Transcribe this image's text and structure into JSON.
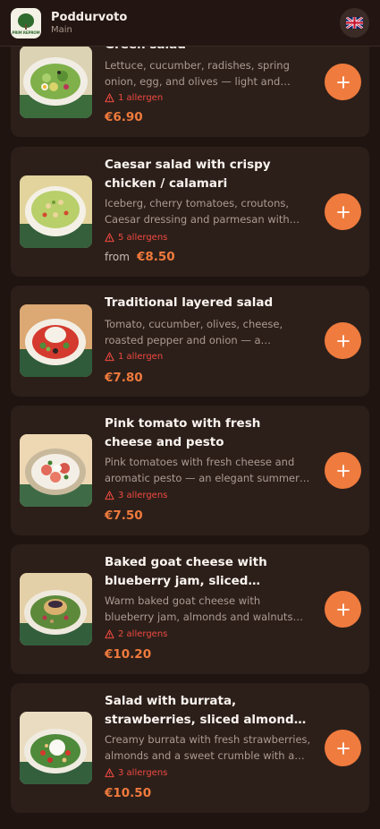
{
  "header": {
    "logo_text": "PRIM REPROM",
    "title": "Poddurvoto",
    "subtitle": "Main",
    "language_icon": "uk-flag-icon"
  },
  "items": [
    {
      "title": "Green salad",
      "description": "Lettuce, cucumber, radishes, spring onion, egg, and olives — light and fresh.",
      "allergens": "1 allergen",
      "price_prefix": "",
      "price": "€6.90"
    },
    {
      "title": "Caesar salad with crispy chicken / calamari",
      "description": "Iceberg, cherry tomatoes, croutons, Caesar dressing and parmesan with crispy chicken or calamari.",
      "allergens": "5 allergens",
      "price_prefix": "from",
      "price": "€8.50"
    },
    {
      "title": "Traditional layered salad",
      "description": "Tomato, cucumber, olives, cheese, roasted pepper and onion — a traditional favourite.",
      "allergens": "1 allergen",
      "price_prefix": "",
      "price": "€7.80"
    },
    {
      "title": "Pink tomato with fresh cheese and pesto",
      "description": "Pink tomatoes with fresh cheese and aromatic pesto — an elegant summer salad.",
      "allergens": "3 allergens",
      "price_prefix": "",
      "price": "€7.50"
    },
    {
      "title": "Baked goat cheese with blueberry jam, sliced almonds, walnuts and mixed salad",
      "description": "Warm baked goat cheese with blueberry jam, almonds and walnuts over a mix of leaves.",
      "allergens": "2 allergens",
      "price_prefix": "",
      "price": "€10.20"
    },
    {
      "title": "Salad with burrata, strawberries, sliced almonds, sweet crumble and greens",
      "description": "Creamy burrata with fresh strawberries, almonds and a sweet crumble with a mix of greens.",
      "allergens": "3 allergens",
      "price_prefix": "",
      "price": "€10.50"
    }
  ],
  "colors": {
    "background": "#201410",
    "card": "#2c1f1a",
    "accent": "#ef7b3e",
    "allergen": "#ef4a40"
  },
  "icons": {
    "add": "plus-icon",
    "allergen": "warning-icon"
  }
}
